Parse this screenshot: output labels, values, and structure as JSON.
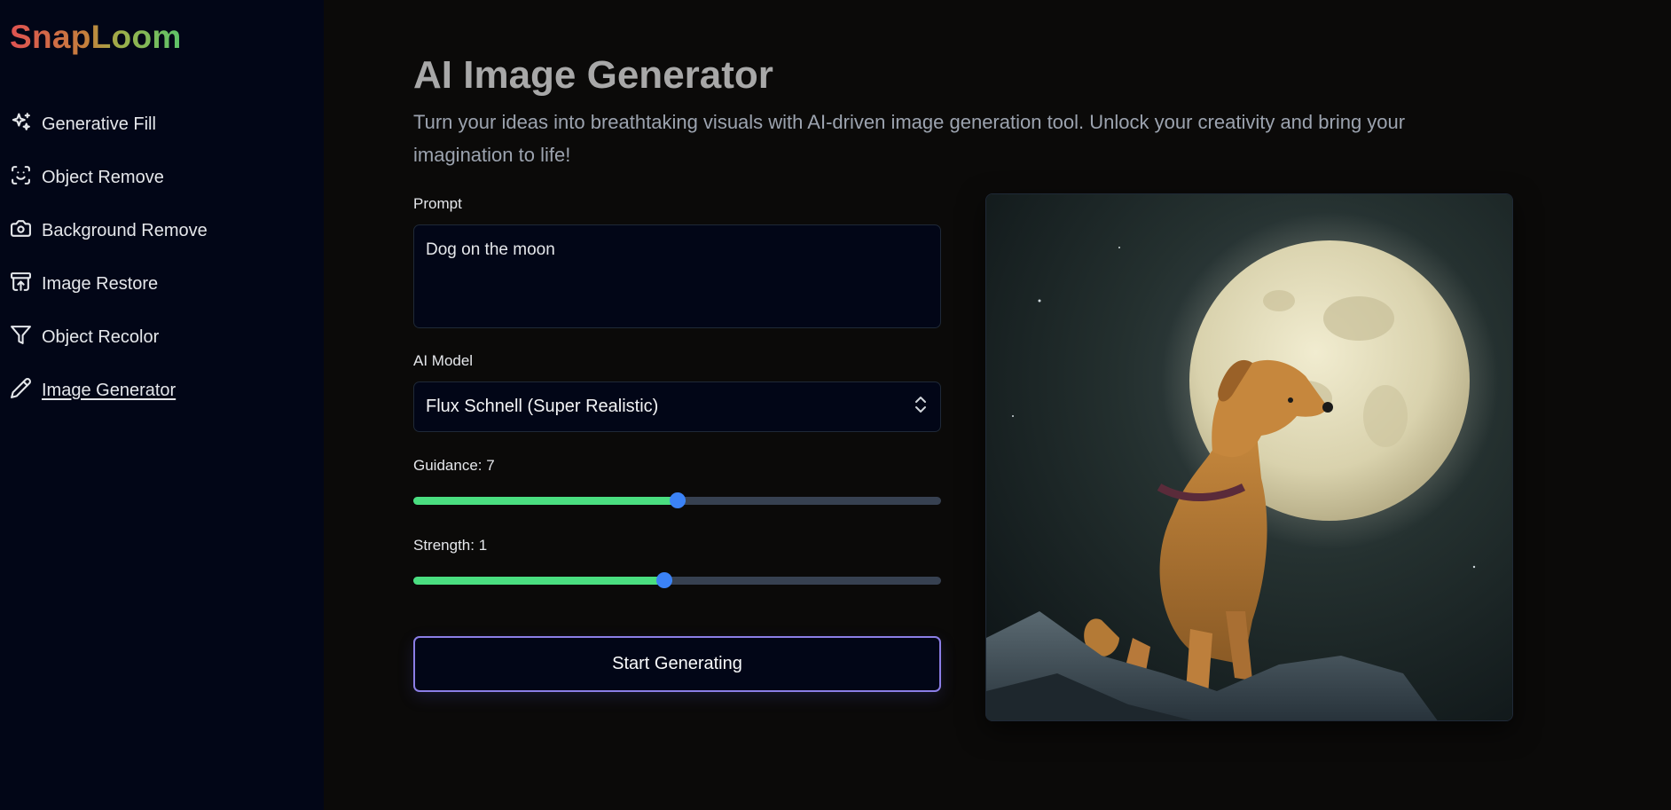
{
  "app": {
    "logo": "SnapLoom"
  },
  "sidebar": {
    "items": [
      {
        "label": "Generative Fill",
        "icon": "sparkles-icon"
      },
      {
        "label": "Object Remove",
        "icon": "scan-face-icon"
      },
      {
        "label": "Background Remove",
        "icon": "camera-icon"
      },
      {
        "label": "Image Restore",
        "icon": "archive-restore-icon"
      },
      {
        "label": "Object Recolor",
        "icon": "filter-icon"
      },
      {
        "label": "Image Generator",
        "icon": "pencil-icon",
        "active": true
      }
    ]
  },
  "main": {
    "title": "AI Image Generator",
    "subtitle": "Turn your ideas into breathtaking visuals with AI-driven image generation tool. Unlock your creativity and bring your imagination to life!",
    "prompt": {
      "label": "Prompt",
      "value": "Dog on the moon"
    },
    "model": {
      "label": "AI Model",
      "value": "Flux Schnell (Super Realistic)"
    },
    "guidance": {
      "label": "Guidance: 7",
      "fraction": 0.5
    },
    "strength": {
      "label": "Strength: 1",
      "fraction": 0.475
    },
    "generate_label": "Start Generating",
    "image_alt": "Generated image of a dog sitting on a rock in front of a full moon"
  },
  "colors": {
    "sidebar_bg": "#020617",
    "page_bg": "#0b0a09",
    "slider_fill": "#4ade80",
    "slider_thumb": "#3b82f6",
    "button_border": "#8b7ee6"
  }
}
